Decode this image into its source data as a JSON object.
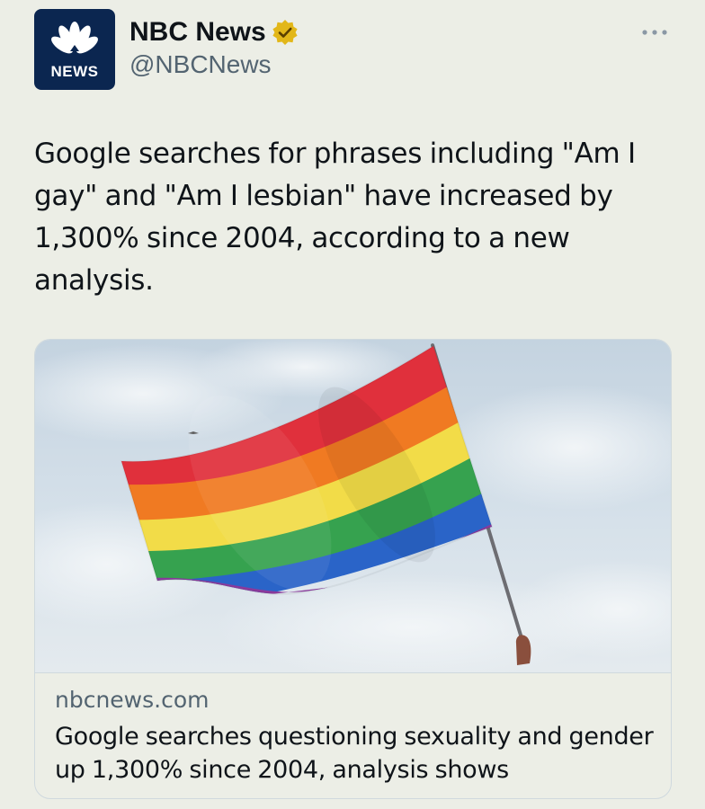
{
  "author": {
    "display_name": "NBC News",
    "handle": "@NBCNews",
    "avatar_text": "NEWS",
    "verified": true,
    "verified_color": "#e2b719",
    "avatar_color": "#0b2650"
  },
  "tweet": {
    "text": "Google searches for phrases including \"Am I gay\" and \"Am I lesbian\" have increased by 1,300% since 2004, according to a new analysis."
  },
  "link_card": {
    "domain": "nbcnews.com",
    "title": "Google searches questioning sexuality and gender up 1,300% since 2004, analysis shows",
    "image_subject": "rainbow pride flag against cloudy sky"
  },
  "icons": {
    "more": "more-horizontal-icon",
    "verified": "verified-badge-icon",
    "logo": "nbc-peacock-icon"
  },
  "colors": {
    "background": "#eceee6",
    "text_primary": "#0f1419",
    "text_secondary": "#536471",
    "border": "#cfd9de"
  }
}
